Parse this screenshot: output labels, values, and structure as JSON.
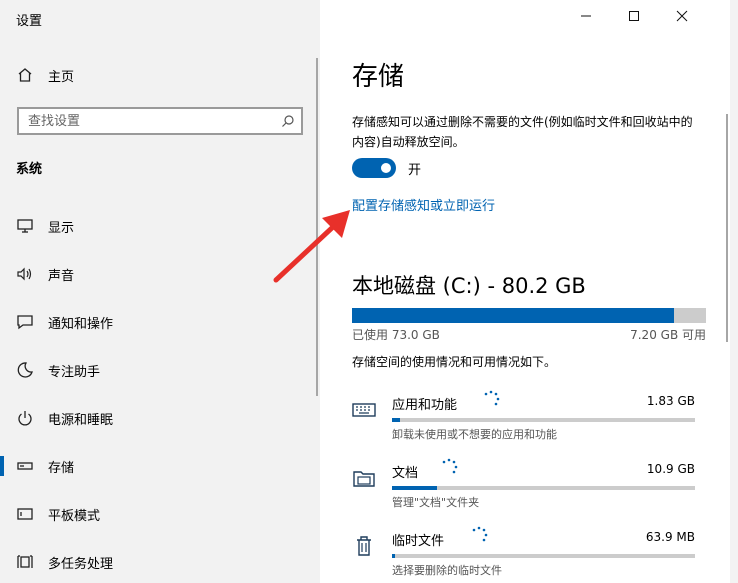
{
  "window": {
    "title": "设置"
  },
  "sidebar": {
    "home": "主页",
    "search_placeholder": "查找设置",
    "section": "系统",
    "items": [
      {
        "label": "显示",
        "icon": "monitor-icon"
      },
      {
        "label": "声音",
        "icon": "speaker-icon"
      },
      {
        "label": "通知和操作",
        "icon": "notification-icon"
      },
      {
        "label": "专注助手",
        "icon": "moon-icon"
      },
      {
        "label": "电源和睡眠",
        "icon": "power-icon"
      },
      {
        "label": "存储",
        "icon": "storage-icon",
        "active": true
      },
      {
        "label": "平板模式",
        "icon": "tablet-icon"
      },
      {
        "label": "多任务处理",
        "icon": "multitask-icon"
      }
    ]
  },
  "main": {
    "title": "存储",
    "description": "存储感知可以通过删除不需要的文件(例如临时文件和回收站中的内容)自动释放空间。",
    "toggle_label": "开",
    "toggle_on": true,
    "config_link": "配置存储感知或立即运行",
    "disk": {
      "title": "本地磁盘 (C:) - 80.2 GB",
      "used_label": "已使用 73.0 GB",
      "free_label": "7.20 GB 可用",
      "used_fraction": 0.91,
      "info": "存储空间的使用情况和可用情况如下。"
    },
    "categories": [
      {
        "name": "应用和功能",
        "size": "1.83 GB",
        "sub": "卸载未使用或不想要的应用和功能",
        "fraction": 0.025,
        "icon": "keyboard-icon"
      },
      {
        "name": "文档",
        "size": "10.9 GB",
        "sub": "管理\"文档\"文件夹",
        "fraction": 0.15,
        "icon": "documents-icon"
      },
      {
        "name": "临时文件",
        "size": "63.9 MB",
        "sub": "选择要删除的临时文件",
        "fraction": 0.01,
        "icon": "trash-icon"
      }
    ]
  },
  "colors": {
    "accent": "#0063b1",
    "annotation_arrow": "#e8302a"
  }
}
